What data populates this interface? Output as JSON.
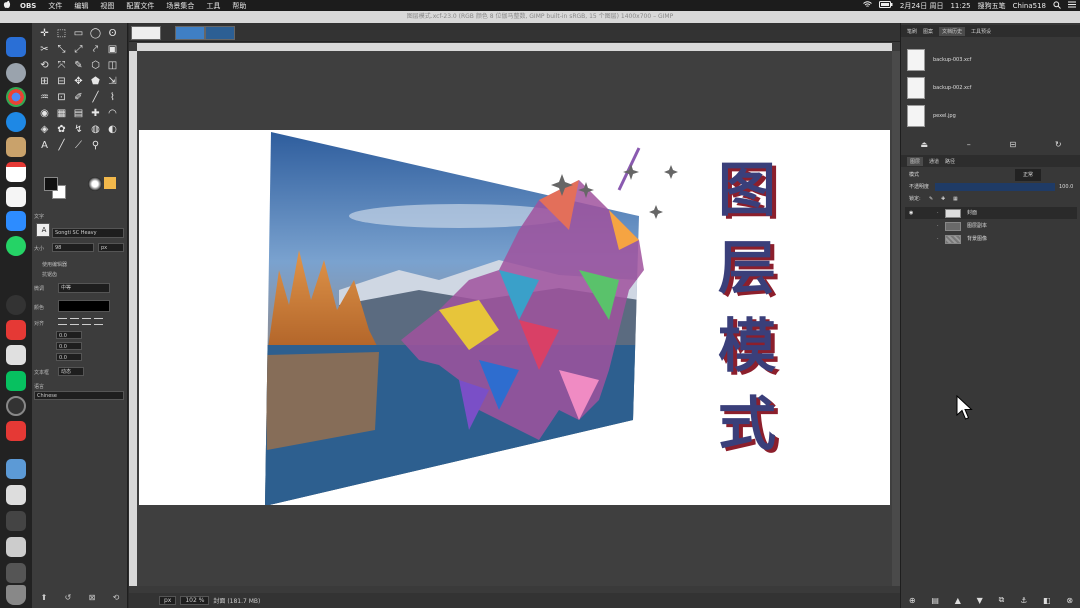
{
  "menubar": {
    "apple": "",
    "app": "OBS",
    "items": [
      "文件",
      "编辑",
      "视图",
      "配置文件",
      "场景集合",
      "工具",
      "帮助"
    ],
    "status": [
      "2月24日 周日",
      "11:25",
      "搜狗五笔",
      "China518"
    ]
  },
  "window": {
    "title": "图层模式.xcf-23.0 (RGB 颜色 8 位伽马整数, GIMP built-in sRGB, 15 个图层) 1400x700 – GIMP"
  },
  "toolbox": {
    "tools": [
      "✛",
      "⬚",
      "▭",
      "◯",
      "ʘ",
      "✂",
      "⤡",
      "⤢",
      "⤤",
      "▣",
      "⟲",
      "⤧",
      "✎",
      "⬡",
      "◫",
      "⊞",
      "⊟",
      "✥",
      "⬟",
      "⇲",
      "♒",
      "⊡",
      "✐",
      "╱",
      "⌇",
      "◉",
      "▦",
      "▤",
      "✚",
      "◠",
      "◈",
      "✿",
      "↯",
      "◍",
      "◐",
      "A",
      "╱",
      "⟋",
      "⚲",
      ""
    ],
    "tool_options_title": "文字",
    "font": "Songti SC Heavy",
    "size_label": "大小",
    "size_value": "98",
    "size_unit": "px",
    "use_editor": "使用编辑器",
    "antialias": "抗锯齿",
    "hinting_label": "微调",
    "hinting_value": "中等",
    "color_label": "颜色",
    "justify_label": "对齐",
    "indent_values": [
      "0.0",
      "0.0",
      "0.0"
    ],
    "box_label": "文本框",
    "box_value": "动态",
    "language_label": "语言",
    "language_value": "Chinese",
    "fg_color": "#111111",
    "bg_color": "#ffffff"
  },
  "canvas": {
    "title_text": [
      "图",
      "层",
      "模",
      "式"
    ],
    "status_unit": "px",
    "status_zoom": "102 %",
    "status_text": "封面 (181.7 MB)",
    "title_color": "#3a3f7a",
    "shadow_color": "#8c1f2c"
  },
  "right_panel": {
    "top_tabs": [
      "笔刷",
      "图案",
      "文档历史",
      "工具预设",
      "历史"
    ],
    "history": [
      {
        "name": "backup-003.xcf"
      },
      {
        "name": "backup-002.xcf"
      },
      {
        "name": "pexel.jpg"
      }
    ],
    "layer_tabs": [
      "图层",
      "通道",
      "路径"
    ],
    "mode_label": "模式",
    "mode_value": "正常",
    "opacity_label": "不透明度",
    "opacity_value": "100.0",
    "lock_label": "锁定:",
    "layers": [
      {
        "name": "封面",
        "visible": true
      },
      {
        "name": "图层副本",
        "visible": false
      },
      {
        "name": "背景图像",
        "visible": false
      }
    ]
  }
}
